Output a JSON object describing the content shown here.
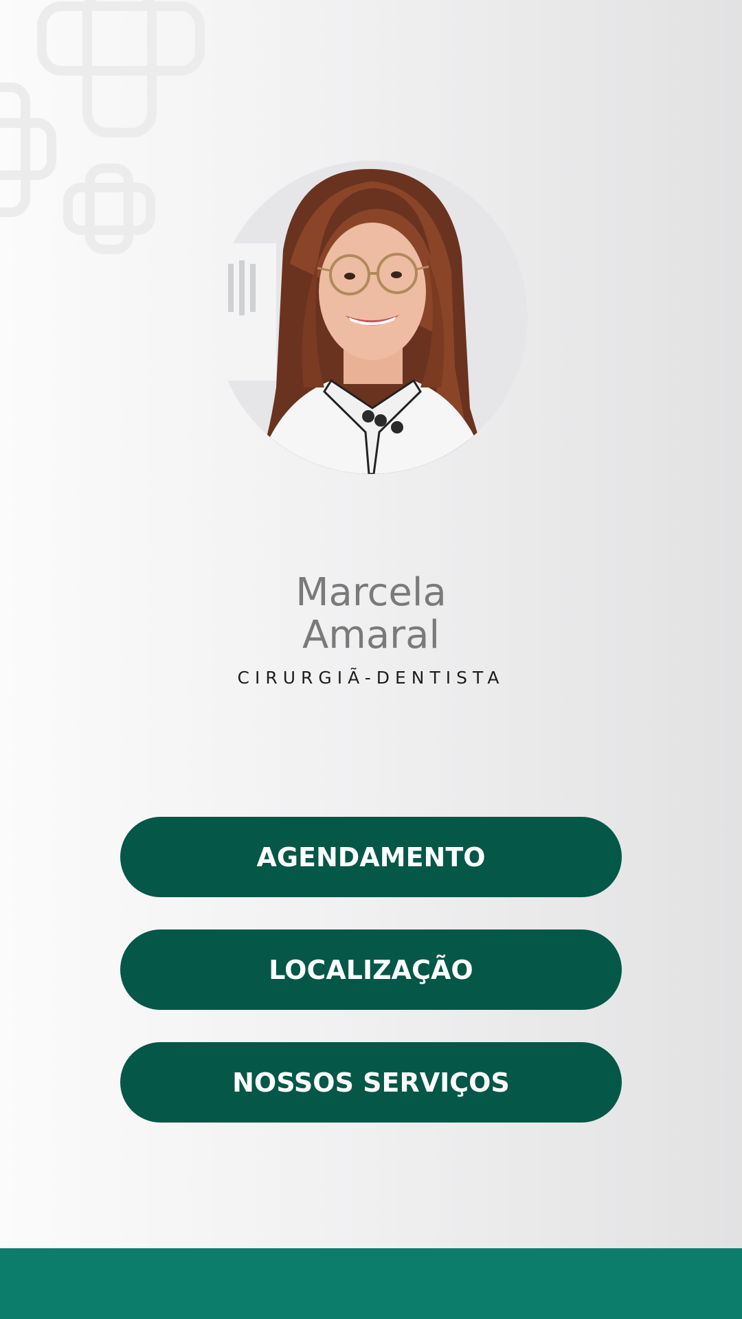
{
  "profile": {
    "first_name": "Marcela",
    "last_name": "Amaral",
    "role": "CIRURGIÃ-DENTISTA"
  },
  "buttons": [
    {
      "label": "AGENDAMENTO"
    },
    {
      "label": "LOCALIZAÇÃO"
    },
    {
      "label": "NOSSOS SERVIÇOS"
    }
  ],
  "colors": {
    "button_bg": "#055748",
    "footer_bg": "#0c7d6b",
    "name_text": "#7a7a7a",
    "role_text": "#1d1d1d"
  },
  "icons": [
    "plus-cross-icon",
    "plus-cross-icon",
    "plus-cross-icon"
  ]
}
